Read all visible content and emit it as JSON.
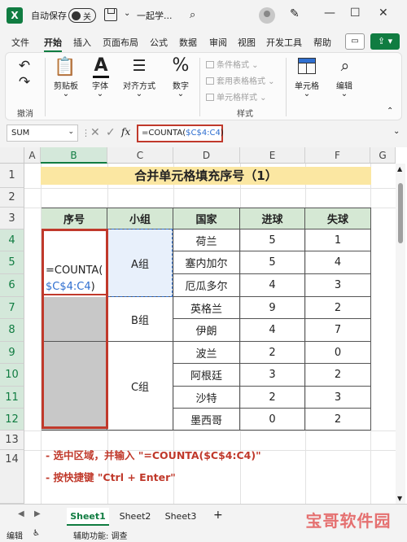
{
  "titlebar": {
    "logo": "X",
    "autosave_label": "自动保存",
    "toggle_state": "关",
    "doc_title": "一起学...",
    "search_icon": "search-icon",
    "minimize": "—",
    "maximize": "☐",
    "close": "✕"
  },
  "menu": {
    "tabs": [
      "文件",
      "开始",
      "插入",
      "页面布局",
      "公式",
      "数据",
      "审阅",
      "视图",
      "开发工具",
      "帮助"
    ],
    "active": "开始"
  },
  "ribbon": {
    "undo_caption": "撤消",
    "clipboard_label": "剪贴板",
    "font_label": "字体",
    "align_label": "对齐方式",
    "number_label": "数字",
    "cond_format": "条件格式",
    "table_format": "套用表格格式",
    "cell_style": "单元格样式",
    "styles_caption": "样式",
    "cells_label": "单元格",
    "edit_label": "编辑"
  },
  "formula_bar": {
    "name_box": "SUM",
    "formula_prefix": "=COUNTA(",
    "formula_ref": "$C$4:C4",
    "formula_suffix": ")"
  },
  "grid": {
    "columns": [
      "A",
      "B",
      "C",
      "D",
      "E",
      "F",
      "G"
    ],
    "rows": [
      "1",
      "2",
      "3",
      "4",
      "5",
      "6",
      "7",
      "8",
      "9",
      "10",
      "11",
      "12",
      "13",
      "14"
    ],
    "title": "合并单元格填充序号（1）",
    "headers": [
      "序号",
      "小组",
      "国家",
      "进球",
      "失球"
    ],
    "groups": [
      "A组",
      "B组",
      "C组"
    ],
    "table_rows": [
      {
        "country": "荷兰",
        "goals": "5",
        "conceded": "1"
      },
      {
        "country": "塞内加尔",
        "goals": "5",
        "conceded": "4"
      },
      {
        "country": "厄瓜多尔",
        "goals": "4",
        "conceded": "3"
      },
      {
        "country": "英格兰",
        "goals": "9",
        "conceded": "2"
      },
      {
        "country": "伊朗",
        "goals": "4",
        "conceded": "7"
      },
      {
        "country": "波兰",
        "goals": "2",
        "conceded": "0"
      },
      {
        "country": "阿根廷",
        "goals": "3",
        "conceded": "2"
      },
      {
        "country": "沙特",
        "goals": "2",
        "conceded": "3"
      },
      {
        "country": "墨西哥",
        "goals": "0",
        "conceded": "2"
      }
    ],
    "edit_line1": "=COUNTA(",
    "edit_line2_ref": "$C$4:C4",
    "edit_line2_suffix": ")",
    "notes": [
      "- 选中区域，并输入 \"=COUNTA($C$4:C4)\"",
      "- 按快捷键 \"Ctrl + Enter\""
    ]
  },
  "sheets": {
    "tabs": [
      "Sheet1",
      "Sheet2",
      "Sheet3"
    ],
    "active": "Sheet1"
  },
  "status": {
    "mode": "编辑",
    "accessibility": "辅助功能: 调查"
  },
  "watermark": "宝哥软件园",
  "colors": {
    "accent": "#107c41",
    "highlight_red": "#c0392b",
    "ref_blue": "#2f6fd0",
    "title_fill": "#fbe7a2",
    "header_fill": "#d5e8d4"
  }
}
